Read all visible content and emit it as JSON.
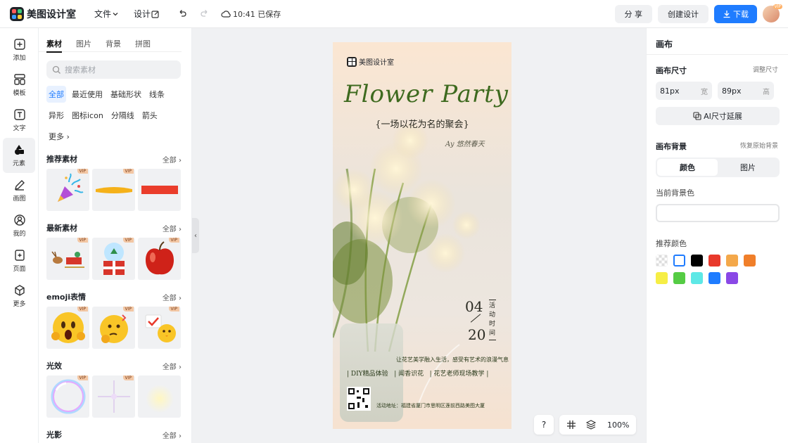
{
  "app": {
    "name": "美图设计室"
  },
  "menu": {
    "file": "文件",
    "design": "设计",
    "saved": "10:41 已保存"
  },
  "actions": {
    "share": "分 享",
    "create": "创建设计",
    "download": "下载",
    "avatar_badge": "VIP"
  },
  "nav": [
    {
      "label": "添加",
      "icon": "plus-square-icon"
    },
    {
      "label": "模板",
      "icon": "template-icon"
    },
    {
      "label": "文字",
      "icon": "text-icon"
    },
    {
      "label": "元素",
      "icon": "shapes-icon"
    },
    {
      "label": "画图",
      "icon": "pencil-icon"
    },
    {
      "label": "我的",
      "icon": "user-icon"
    },
    {
      "label": "页面",
      "icon": "page-add-icon"
    },
    {
      "label": "更多",
      "icon": "cube-icon"
    }
  ],
  "panel": {
    "tabs": [
      "素材",
      "图片",
      "背景",
      "拼图"
    ],
    "search_placeholder": "搜索素材",
    "chips": [
      "全部",
      "最近使用",
      "基础形状",
      "线条",
      "异形",
      "图标icon",
      "分隔线",
      "箭头",
      "更多"
    ],
    "vip": "VIP",
    "all": "全部",
    "sections": [
      {
        "title": "推荐素材",
        "items": [
          "party-popper",
          "orange-brush-stroke",
          "red-bar"
        ]
      },
      {
        "title": "最新素材",
        "items": [
          "sleigh",
          "snow-globe-gift",
          "red-apple"
        ]
      },
      {
        "title": "emoji表情",
        "items": [
          "shocked-emoji",
          "thinking-emoji",
          "chick-emoji"
        ]
      },
      {
        "title": "光效",
        "items": [
          "bubble-ring",
          "sparkle-star",
          "glow"
        ]
      },
      {
        "title": "光影",
        "items": []
      }
    ]
  },
  "poster": {
    "brand": "美图设计室",
    "title": "Flower Party",
    "subtitle": "{一场以花为名的聚会}",
    "signature": "Ay 悠然春天",
    "date_month": "04",
    "date_day": "20",
    "date_label": "活动时间",
    "desc": "让花艺美学融入生活，感受有艺术的浪漫气息",
    "events": "| DIY精品体验   | 闻香识花   | 花艺老师现场教学 |",
    "address": "活动地址：福建省厦门市思明区莲前西路美图大厦"
  },
  "canvas_tools": {
    "help": "?",
    "zoom": "100%"
  },
  "right_panel": {
    "title": "画布",
    "size_label": "画布尺寸",
    "size_adjust": "调整尺寸",
    "width_value": "81px",
    "width_unit": "宽",
    "height_value": "89px",
    "height_unit": "高",
    "ai_extend": "AI尺寸延展",
    "bg_label": "画布背景",
    "bg_restore": "恢复原始背景",
    "seg_color": "颜色",
    "seg_image": "图片",
    "current_bg": "当前背景色",
    "recommend": "推荐颜色",
    "swatches": [
      "transparent",
      "#ffffff",
      "#000000",
      "#e8392b",
      "#f4a84a",
      "#f07f2a",
      "#f6ee45",
      "#55cc44",
      "#5de8e6",
      "#1f7cff",
      "#8a48e6"
    ]
  },
  "colors": {
    "accent": "#1f7cff",
    "poster_green": "#3e6a1f"
  }
}
